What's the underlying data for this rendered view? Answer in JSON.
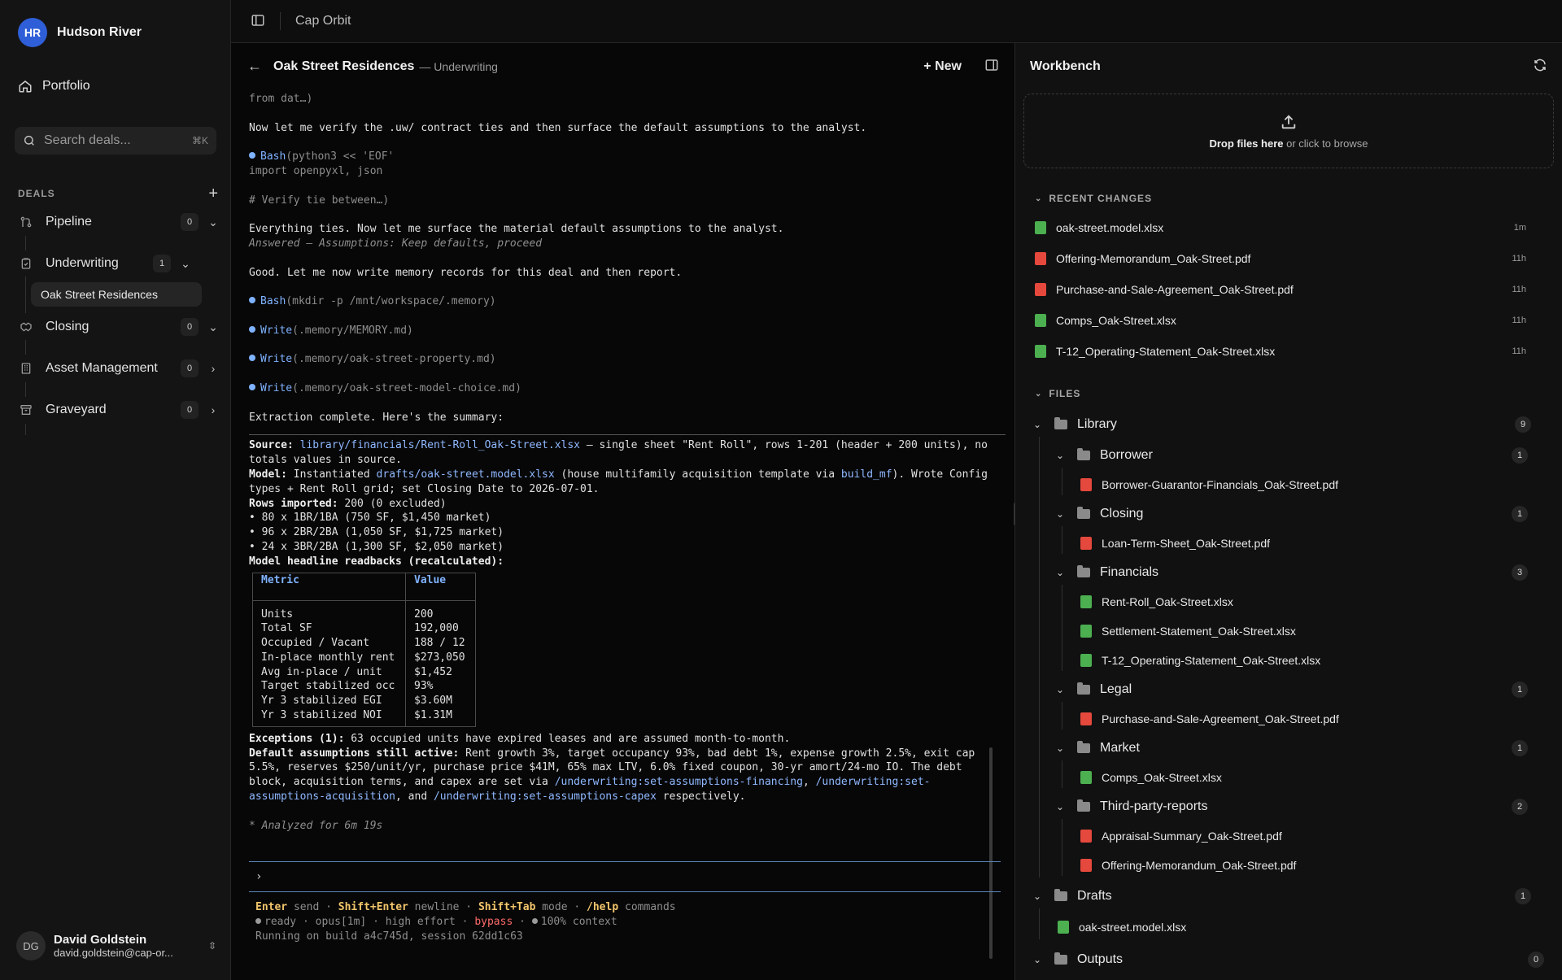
{
  "org": {
    "initials": "HR",
    "name": "Hudson River"
  },
  "nav": {
    "portfolio": "Portfolio"
  },
  "search": {
    "placeholder": "Search deals...",
    "shortcut": "⌘K"
  },
  "deals": {
    "label": "DEALS",
    "stages": [
      {
        "name": "Pipeline",
        "count": "0",
        "icon": "pipeline-icon",
        "chevron": "chevron-down"
      },
      {
        "name": "Underwriting",
        "count": "1",
        "icon": "clipboard-icon",
        "chevron": "chevron-down"
      },
      {
        "name": "Closing",
        "count": "0",
        "icon": "handshake-icon",
        "chevron": "chevron-down"
      },
      {
        "name": "Asset Management",
        "count": "0",
        "icon": "building-icon",
        "chevron": "chevron-right"
      },
      {
        "name": "Graveyard",
        "count": "0",
        "icon": "archive-icon",
        "chevron": "chevron-right"
      }
    ],
    "active_deal": "Oak Street Residences"
  },
  "user": {
    "initials": "DG",
    "name": "David Goldstein",
    "email": "david.goldstein@cap-or..."
  },
  "topbar": {
    "app_name": "Cap Orbit"
  },
  "conversation": {
    "title": "Oak Street Residences",
    "subtitle": "— Underwriting",
    "new_label": "New"
  },
  "transcript": {
    "l1": "from dat…)",
    "l2": "Now let me verify the .uw/ contract ties and then surface the default assumptions to the analyst.",
    "bash1_tool": "Bash",
    "bash1_arg": "(python3 << 'EOF'",
    "bash1_cont": "import openpyxl, json",
    "comment": "# Verify tie between…)",
    "l3": "Everything ties. Now let me surface the material default assumptions to the analyst.",
    "answered": "Answered — Assumptions: Keep defaults, proceed",
    "l4": "Good. Let me now write memory records for this deal and then report.",
    "bash2_tool": "Bash",
    "bash2_arg": "(mkdir -p /mnt/workspace/.memory)",
    "write_tool": "Write",
    "write1": "(.memory/MEMORY.md)",
    "write2": "(.memory/oak-street-property.md)",
    "write3": "(.memory/oak-street-model-choice.md)",
    "l5": "Extraction complete. Here's the summary:",
    "source_label": "Source:",
    "source_path": "library/financials/Rent-Roll_Oak-Street.xlsx",
    "source_rest": " — single sheet \"Rent Roll\", rows 1-201 (header + 200 units), no totals values in source.",
    "model_label": "Model:",
    "model_text1": " Instantiated ",
    "model_path": "drafts/oak-street.model.xlsx",
    "model_text2": " (house multifamily acquisition template via ",
    "model_fn": "build_mf",
    "model_text3": "). Wrote Config types + Rent Roll grid; set Closing Date to 2026-07-01.",
    "rows_label": "Rows imported:",
    "rows_value": " 200 (0 excluded)",
    "unit1": "• 80 x 1BR/1BA (750 SF, $1,450 market)",
    "unit2": "• 96 x 2BR/2BA (1,050 SF, $1,725 market)",
    "unit3": "• 24 x 3BR/2BA (1,300 SF, $2,050 market)",
    "readbacks_label": "Model headline readbacks (recalculated):",
    "exceptions_label": "Exceptions (1):",
    "exceptions_text": " 63 occupied units have expired leases and are assumed month-to-month.",
    "defaults_label": "Default assumptions still active:",
    "defaults_text": " Rent growth 3%, target occupancy 93%, bad debt 1%, expense growth 2.5%, exit cap 5.5%, reserves $250/unit/yr, purchase price $41M, 65% max LTV, 6.0% fixed coupon, 30-yr amort/24-mo IO. The debt block, acquisition terms, and capex are set via ",
    "cmd1": "/underwriting:set-assumptions-financing",
    "comma": ",",
    "cmd2": "/underwriting:set-assumptions-acquisition",
    "and": ", and ",
    "cmd3": "/underwriting:set-assumptions-capex",
    "respectively": " respectively.",
    "analyzed": "* Analyzed for 6m 19s"
  },
  "metrics_table": {
    "headers": [
      "Metric",
      "Value"
    ],
    "rows": [
      [
        "Units",
        "200"
      ],
      [
        "Total SF",
        "192,000"
      ],
      [
        "Occupied / Vacant",
        "188 / 12"
      ],
      [
        "In-place monthly rent",
        "$273,050"
      ],
      [
        "Avg in-place / unit",
        "$1,452"
      ],
      [
        "Target stabilized occ",
        "93%"
      ],
      [
        "Yr 3 stabilized EGI",
        "$3.60M"
      ],
      [
        "Yr 3 stabilized NOI",
        "$1.31M"
      ]
    ]
  },
  "prompt": {
    "caret": "›"
  },
  "help": {
    "enter": "Enter",
    "send": " send · ",
    "shift_enter": "Shift+Enter",
    "newline": " newline · ",
    "shift_tab": "Shift+Tab",
    "mode": " mode · ",
    "help_cmd": "/help",
    "commands": " commands",
    "ready": "ready",
    "model": "opus[1m]",
    "effort": "high effort",
    "bypass": "bypass",
    "context": "100% context",
    "sep": "·",
    "build": "Running on build a4c745d, session 62dd1c63"
  },
  "workbench": {
    "title": "Workbench",
    "drop_bold": "Drop files here",
    "drop_rest": " or click to browse",
    "recent_label": "RECENT CHANGES",
    "recent": [
      {
        "name": "oak-street.model.xlsx",
        "type": "xlsx",
        "time": "1m"
      },
      {
        "name": "Offering-Memorandum_Oak-Street.pdf",
        "type": "pdf",
        "time": "11h"
      },
      {
        "name": "Purchase-and-Sale-Agreement_Oak-Street.pdf",
        "type": "pdf",
        "time": "11h"
      },
      {
        "name": "Comps_Oak-Street.xlsx",
        "type": "xlsx",
        "time": "11h"
      },
      {
        "name": "T-12_Operating-Statement_Oak-Street.xlsx",
        "type": "xlsx",
        "time": "11h"
      }
    ],
    "files_label": "FILES",
    "library": {
      "name": "Library",
      "count": "9"
    },
    "folders": [
      {
        "name": "Borrower",
        "count": "1",
        "files": [
          {
            "name": "Borrower-Guarantor-Financials_Oak-Street.pdf",
            "type": "pdf"
          }
        ]
      },
      {
        "name": "Closing",
        "count": "1",
        "files": [
          {
            "name": "Loan-Term-Sheet_Oak-Street.pdf",
            "type": "pdf"
          }
        ]
      },
      {
        "name": "Financials",
        "count": "3",
        "files": [
          {
            "name": "Rent-Roll_Oak-Street.xlsx",
            "type": "xlsx"
          },
          {
            "name": "Settlement-Statement_Oak-Street.xlsx",
            "type": "xlsx"
          },
          {
            "name": "T-12_Operating-Statement_Oak-Street.xlsx",
            "type": "xlsx"
          }
        ]
      },
      {
        "name": "Legal",
        "count": "1",
        "files": [
          {
            "name": "Purchase-and-Sale-Agreement_Oak-Street.pdf",
            "type": "pdf"
          }
        ]
      },
      {
        "name": "Market",
        "count": "1",
        "files": [
          {
            "name": "Comps_Oak-Street.xlsx",
            "type": "xlsx"
          }
        ]
      },
      {
        "name": "Third-party-reports",
        "count": "2",
        "files": [
          {
            "name": "Appraisal-Summary_Oak-Street.pdf",
            "type": "pdf"
          },
          {
            "name": "Offering-Memorandum_Oak-Street.pdf",
            "type": "pdf"
          }
        ]
      }
    ],
    "drafts": {
      "name": "Drafts",
      "count": "1",
      "files": [
        {
          "name": "oak-street.model.xlsx",
          "type": "xlsx"
        }
      ]
    },
    "outputs": {
      "name": "Outputs",
      "count": "0"
    }
  },
  "colors": {
    "accent": "#2f5fd8",
    "tool": "#7fb2ff",
    "key": "#f2c66b",
    "bypass": "#ff6b6b",
    "xlsx": "#4caf50",
    "pdf": "#e5483c"
  }
}
